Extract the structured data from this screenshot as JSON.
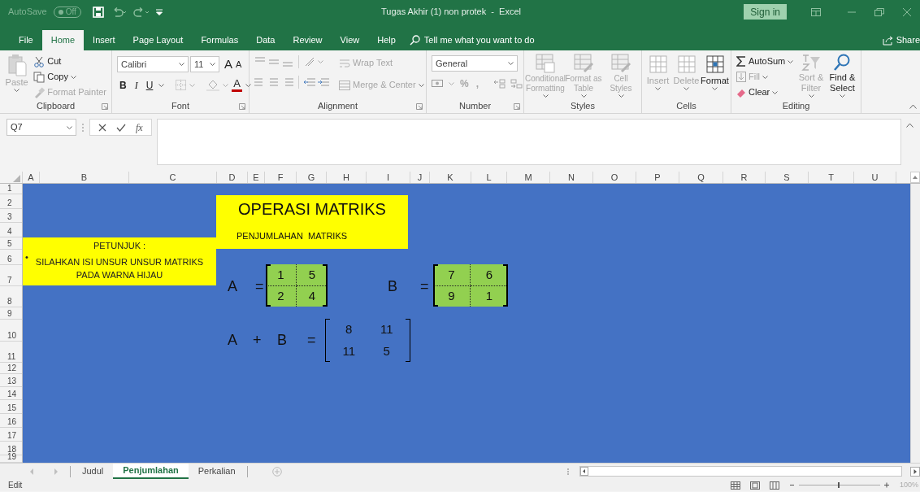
{
  "title_bar": {
    "autosave_label": "AutoSave",
    "autosave_toggle": "Off",
    "document_title": "Tugas Akhir (1) non protek  -  Excel",
    "sign_in": "Sign in"
  },
  "ribbon_tabs": [
    {
      "label": "File",
      "selected": false
    },
    {
      "label": "Home",
      "selected": true
    },
    {
      "label": "Insert",
      "selected": false
    },
    {
      "label": "Page Layout",
      "selected": false
    },
    {
      "label": "Formulas",
      "selected": false
    },
    {
      "label": "Data",
      "selected": false
    },
    {
      "label": "Review",
      "selected": false
    },
    {
      "label": "View",
      "selected": false
    },
    {
      "label": "Help",
      "selected": false
    }
  ],
  "tell_me": "Tell me what you want to do",
  "share": "Share",
  "ribbon_groups": [
    {
      "name": "Clipboard",
      "kind": "clipboard",
      "launcher": true,
      "buttons": [
        {
          "label": "Paste",
          "disabled": true
        },
        {
          "label": "Cut",
          "disabled": false
        },
        {
          "label": "Copy",
          "disabled": false
        },
        {
          "label": "Format Painter",
          "disabled": true
        }
      ]
    },
    {
      "name": "Font",
      "kind": "font",
      "launcher": true,
      "font_name": "Calibri",
      "font_size": "11",
      "buttons": [
        {
          "kind": "grow",
          "label": "A",
          "disabled": false
        },
        {
          "kind": "shrink",
          "label": "A",
          "disabled": false
        },
        {
          "kind": "bold",
          "label": "B",
          "disabled": false
        },
        {
          "kind": "italic",
          "label": "I",
          "disabled": false
        },
        {
          "kind": "underline",
          "label": "U",
          "disabled": false
        },
        {
          "kind": "font_color",
          "label": "A",
          "disabled": false
        }
      ]
    },
    {
      "name": "Alignment",
      "kind": "alignment",
      "launcher": true,
      "buttons": [
        {
          "label": "Wrap Text",
          "disabled": true
        },
        {
          "label": "Merge & Center",
          "disabled": true
        }
      ]
    },
    {
      "name": "Number",
      "kind": "number",
      "launcher": true,
      "number_format": "General",
      "buttons": [
        {
          "label": "%",
          "disabled": true
        },
        {
          "label": ",",
          "disabled": true
        }
      ]
    },
    {
      "name": "Styles",
      "kind": "styles",
      "launcher": false,
      "buttons": [
        {
          "label": "Conditional Formatting",
          "disabled": true
        },
        {
          "label": "Format as Table",
          "disabled": true
        },
        {
          "label": "Cell Styles",
          "disabled": true
        }
      ]
    },
    {
      "name": "Cells",
      "kind": "cells",
      "launcher": false,
      "buttons": [
        {
          "label": "Insert",
          "disabled": true
        },
        {
          "label": "Delete",
          "disabled": true
        },
        {
          "label": "Format",
          "disabled": false
        }
      ]
    },
    {
      "name": "Editing",
      "kind": "editing",
      "launcher": false,
      "buttons": [
        {
          "label": "AutoSum",
          "disabled": false
        },
        {
          "label": "Fill",
          "disabled": true
        },
        {
          "label": "Clear",
          "disabled": false
        },
        {
          "label": "Sort & Filter",
          "disabled": true
        },
        {
          "label": "Find & Select",
          "disabled": false
        }
      ]
    }
  ],
  "formula_bar": {
    "name_box": "Q7",
    "function_label": "fx"
  },
  "columns": [
    "A",
    "B",
    "C",
    "D",
    "E",
    "F",
    "G",
    "H",
    "I",
    "J",
    "K",
    "L",
    "M",
    "N",
    "O",
    "P",
    "Q",
    "R",
    "S",
    "T",
    "U"
  ],
  "rows": [
    "1",
    "2",
    "3",
    "4",
    "5",
    "6",
    "7",
    "8",
    "9",
    "10",
    "11",
    "12",
    "13",
    "14",
    "15",
    "16",
    "17",
    "18",
    "19"
  ],
  "sheet": {
    "instructions": {
      "heading": "PETUNJUK :",
      "bullet": "•",
      "lines": [
        "SILAHKAN ISI UNSUR UNSUR MATRIKS",
        "PADA WARNA HIJAU"
      ]
    },
    "title_box": {
      "title": "OPERASI MATRIKS",
      "subtitle": "PENJUMLAHAN  MATRIKS"
    },
    "matrix_a": {
      "name": "A",
      "equals": "=",
      "cells": [
        [
          "1",
          "5"
        ],
        [
          "2",
          "4"
        ]
      ]
    },
    "matrix_b": {
      "name": "B",
      "equals": "=",
      "cells": [
        [
          "7",
          "6"
        ],
        [
          "9",
          "1"
        ]
      ]
    },
    "sum": {
      "terms": [
        "A",
        "+",
        "B",
        "="
      ],
      "cells": [
        [
          "8",
          "11"
        ],
        [
          "11",
          "5"
        ]
      ]
    }
  },
  "sheet_tabs": [
    {
      "label": "Judul",
      "selected": false
    },
    {
      "label": "Penjumlahan",
      "selected": true
    },
    {
      "label": "Perkalian",
      "selected": false
    }
  ],
  "status_bar": {
    "mode": "Edit",
    "zoom": "100%"
  }
}
